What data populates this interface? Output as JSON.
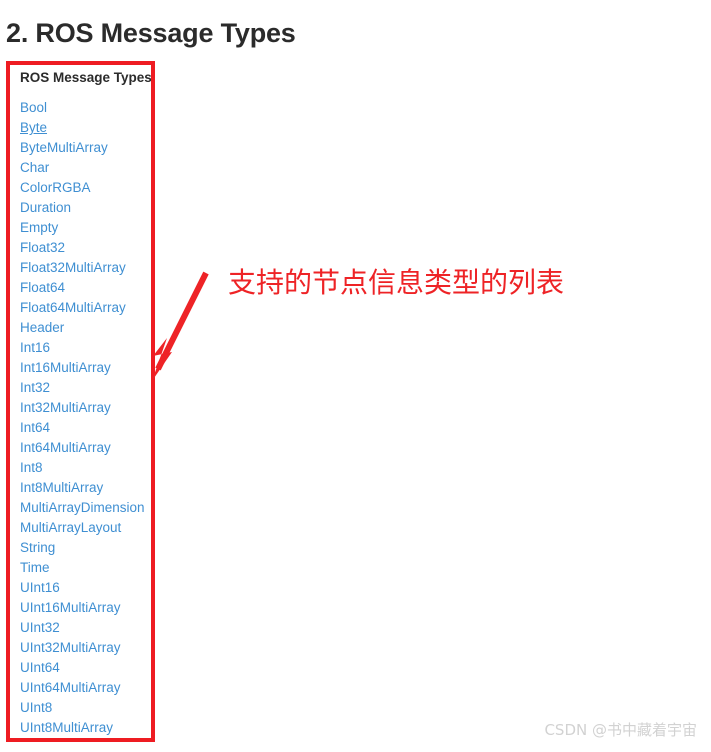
{
  "page": {
    "title": "2. ROS Message Types",
    "background_color": "#ffffff",
    "title_color": "#2b2b2b"
  },
  "message_panel": {
    "header": "ROS Message Types",
    "link_color": "#3f8fd2",
    "hovered_item": "Byte",
    "items": [
      "Bool",
      "Byte",
      "ByteMultiArray",
      "Char",
      "ColorRGBA",
      "Duration",
      "Empty",
      "Float32",
      "Float32MultiArray",
      "Float64",
      "Float64MultiArray",
      "Header",
      "Int16",
      "Int16MultiArray",
      "Int32",
      "Int32MultiArray",
      "Int64",
      "Int64MultiArray",
      "Int8",
      "Int8MultiArray",
      "MultiArrayDimension",
      "MultiArrayLayout",
      "String",
      "Time",
      "UInt16",
      "UInt16MultiArray",
      "UInt32",
      "UInt32MultiArray",
      "UInt64",
      "UInt64MultiArray",
      "UInt8",
      "UInt8MultiArray"
    ]
  },
  "annotation": {
    "text": "支持的节点信息类型的列表",
    "color": "#ee2326",
    "box_color": "#ee1c22",
    "arrow_name": "down-left-arrow-icon"
  },
  "watermark": {
    "text": "CSDN @书中藏着宇宙",
    "color": "#d2d2d2"
  }
}
